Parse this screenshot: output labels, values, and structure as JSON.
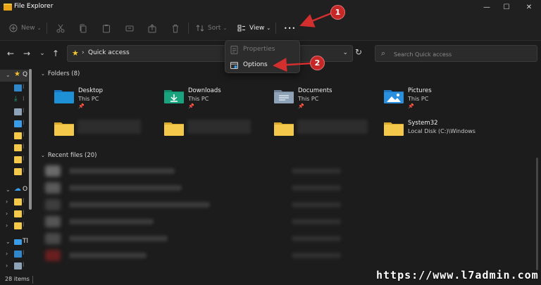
{
  "window": {
    "title": "File Explorer",
    "minimize": "—",
    "maximize": "☐",
    "close": "✕"
  },
  "toolbar": {
    "new_label": "New",
    "sort_label": "Sort",
    "view_label": "View",
    "more_label": "•••"
  },
  "address": {
    "path": "Quick access"
  },
  "search": {
    "placeholder": "Search Quick access"
  },
  "sidebar": {
    "items": [
      {
        "label": "Q",
        "icon": "star-icon"
      },
      {
        "label": "I",
        "icon": "desktop-icon"
      },
      {
        "label": "I",
        "icon": "download-icon"
      },
      {
        "label": "I",
        "icon": "documents-icon"
      },
      {
        "label": "I",
        "icon": "pictures-icon"
      },
      {
        "label": "I",
        "icon": "folder-icon"
      },
      {
        "label": "I",
        "icon": "folder-icon"
      },
      {
        "label": "I",
        "icon": "folder-icon"
      },
      {
        "label": "I",
        "icon": "folder-icon"
      },
      {
        "label": "O",
        "icon": "onedrive-icon"
      },
      {
        "label": "I",
        "icon": "folder-icon"
      },
      {
        "label": "I",
        "icon": "folder-icon"
      },
      {
        "label": "I",
        "icon": "folder-icon"
      },
      {
        "label": "Tl",
        "icon": "this-pc-icon"
      },
      {
        "label": "I",
        "icon": "desktop-icon"
      },
      {
        "label": "I",
        "icon": "documents-icon"
      }
    ]
  },
  "folders_group": {
    "label": "Folders (8)",
    "items": [
      {
        "name": "Desktop",
        "location": "This PC",
        "pinned": true,
        "icon": "desktop-folder-icon"
      },
      {
        "name": "Downloads",
        "location": "This PC",
        "pinned": true,
        "icon": "downloads-folder-icon"
      },
      {
        "name": "Documents",
        "location": "This PC",
        "pinned": true,
        "icon": "documents-folder-icon"
      },
      {
        "name": "Pictures",
        "location": "This PC",
        "pinned": true,
        "icon": "pictures-folder-icon"
      },
      {
        "name": "",
        "location": "",
        "pinned": false,
        "icon": "folder-icon"
      },
      {
        "name": "",
        "location": "",
        "pinned": false,
        "icon": "folder-icon"
      },
      {
        "name": "",
        "location": "",
        "pinned": false,
        "icon": "folder-icon"
      },
      {
        "name": "System32",
        "location": "Local Disk (C:)\\Windows",
        "pinned": false,
        "icon": "folder-icon"
      }
    ]
  },
  "recent_group": {
    "label": "Recent files (20)"
  },
  "menu": {
    "items": [
      {
        "label": "Properties",
        "enabled": false
      },
      {
        "label": "Options",
        "enabled": true
      }
    ]
  },
  "callouts": [
    "1",
    "2"
  ],
  "status": {
    "item_count": "28 items"
  },
  "watermark": "https://www.l7admin.com",
  "colors": {
    "accent_red": "#c62828",
    "folder_yellow": "#f4c84a",
    "desktop_blue": "#1e90d6",
    "downloads_teal": "#19a37f",
    "pictures_blue": "#2b8fe0",
    "background": "#1c1c1c"
  }
}
